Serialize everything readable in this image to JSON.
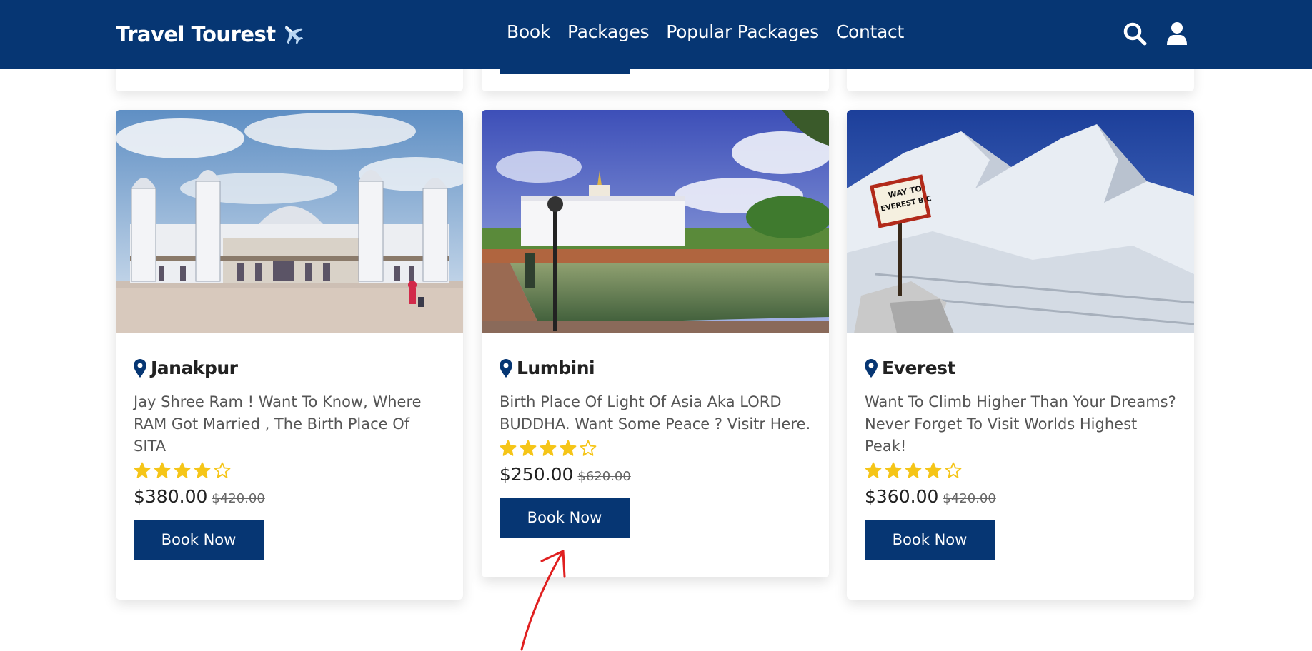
{
  "brand": {
    "name": "Travel Tourest",
    "icon": "airplane-icon"
  },
  "nav": {
    "links": [
      "Book",
      "Packages",
      "Popular Packages",
      "Contact"
    ],
    "icons": [
      "search-icon",
      "user-icon"
    ]
  },
  "colors": {
    "primary": "#063673",
    "star": "#f5c518",
    "annotation": "#e02020"
  },
  "packages": [
    {
      "title": "Janakpur",
      "description": "Jay Shree Ram ! Want To Know, Where RAM Got Married , The Birth Place Of SITA",
      "rating": 4,
      "rating_max": 5,
      "price": "$380.00",
      "old_price": "$420.00",
      "button": "Book Now"
    },
    {
      "title": "Lumbini",
      "description": "Birth Place Of Light Of Asia Aka LORD BUDDHA. Want Some Peace ? Visitr Here.",
      "rating": 4,
      "rating_max": 5,
      "price": "$250.00",
      "old_price": "$620.00",
      "button": "Book Now"
    },
    {
      "title": "Everest",
      "description": "Want To Climb Higher Than Your Dreams? Never Forget To Visit Worlds Highest Peak!",
      "rating": 4,
      "rating_max": 5,
      "price": "$360.00",
      "old_price": "$420.00",
      "button": "Book Now"
    }
  ],
  "everest_sign": [
    "WAY TO",
    "EVEREST B.C"
  ]
}
